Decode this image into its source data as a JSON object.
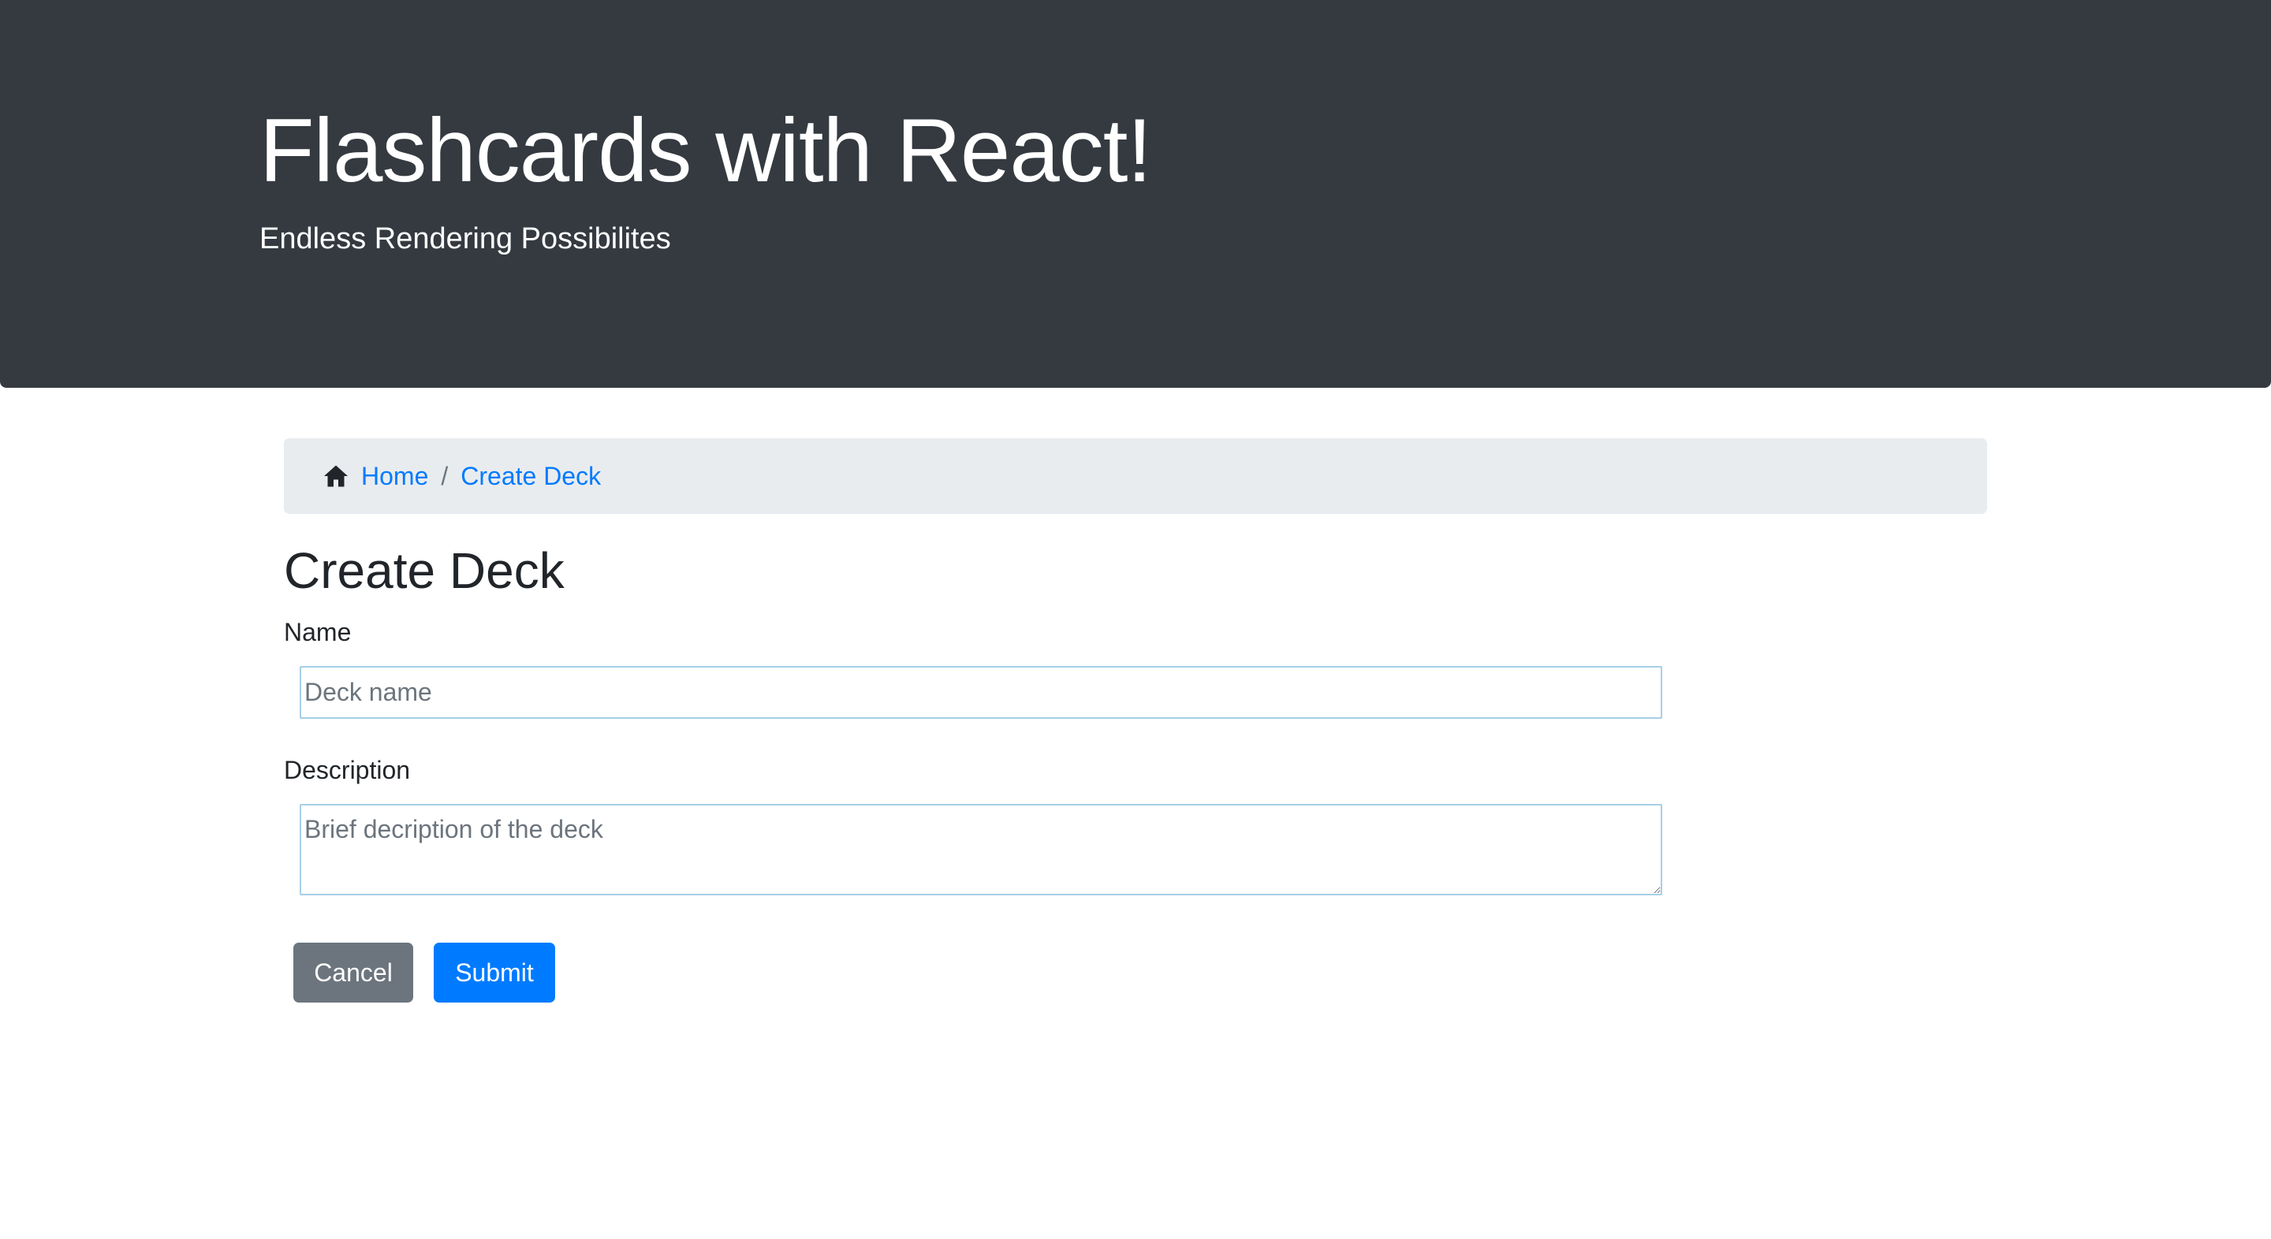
{
  "header": {
    "title": "Flashcards with React!",
    "subtitle": "Endless Rendering Possibilites",
    "background_color": "#343a40"
  },
  "breadcrumb": {
    "home_icon": "home-icon",
    "items": [
      {
        "label": "Home"
      },
      {
        "label": "Create Deck"
      }
    ],
    "separator": "/"
  },
  "page": {
    "title": "Create Deck"
  },
  "form": {
    "name_label": "Name",
    "name_value": "",
    "name_placeholder": "Deck name",
    "description_label": "Description",
    "description_value": "",
    "description_placeholder": "Brief decription of the deck",
    "cancel_label": "Cancel",
    "submit_label": "Submit"
  },
  "colors": {
    "link": "#007bff",
    "cancel": "#6c757d",
    "submit": "#007bff"
  }
}
